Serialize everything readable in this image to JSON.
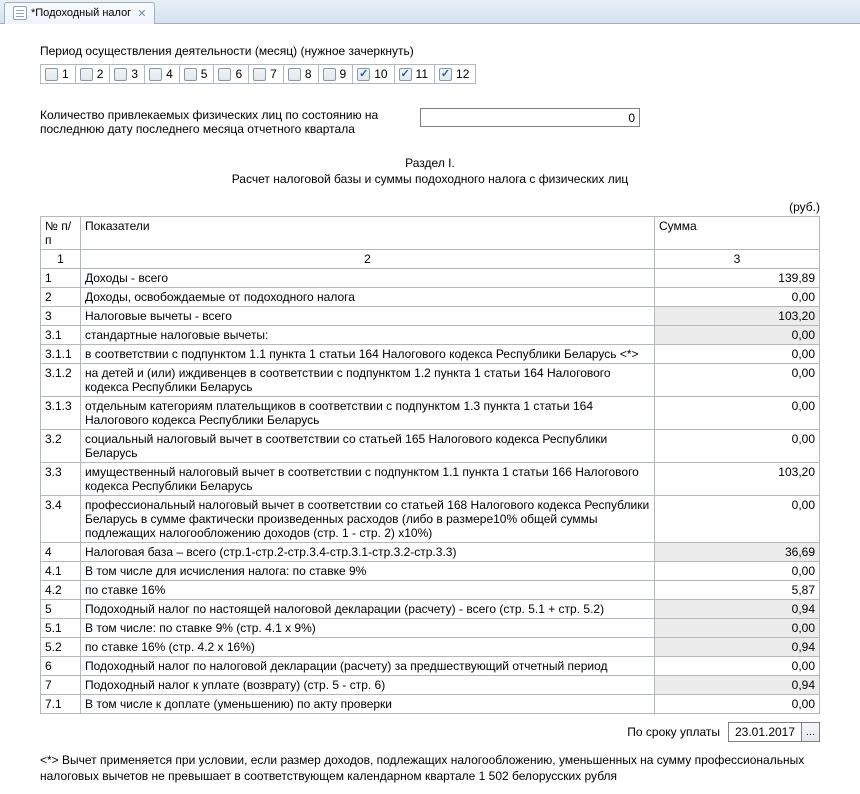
{
  "tab": {
    "title": "*Подоходный налог"
  },
  "period": {
    "label": "Период осуществления деятельности (месяц) (нужное зачеркнуть)",
    "months": [
      {
        "n": "1",
        "checked": false
      },
      {
        "n": "2",
        "checked": false
      },
      {
        "n": "3",
        "checked": false
      },
      {
        "n": "4",
        "checked": false
      },
      {
        "n": "5",
        "checked": false
      },
      {
        "n": "6",
        "checked": false
      },
      {
        "n": "7",
        "checked": false
      },
      {
        "n": "8",
        "checked": false
      },
      {
        "n": "9",
        "checked": false
      },
      {
        "n": "10",
        "checked": true
      },
      {
        "n": "11",
        "checked": true
      },
      {
        "n": "12",
        "checked": true
      }
    ]
  },
  "qty": {
    "label": "Количество привлекаемых физических лиц по состоянию на последнюю дату последнего месяца отчетного квартала",
    "value": "0"
  },
  "section": {
    "title": "Раздел I.",
    "subtitle": "Расчет налоговой базы и суммы подоходного налога с физических лиц",
    "unit": "(руб.)"
  },
  "table": {
    "headers": {
      "num": "№ п/п",
      "ind": "Показатели",
      "sum": "Сумма"
    },
    "subheaders": {
      "num": "1",
      "ind": "2",
      "sum": "3"
    },
    "rows": [
      {
        "n": "1",
        "ind": "Доходы - всего",
        "sum": "139,89",
        "gray": false
      },
      {
        "n": "2",
        "ind": "Доходы, освобождаемые от подоходного налога",
        "sum": "0,00",
        "gray": false
      },
      {
        "n": "3",
        "ind": "Налоговые вычеты - всего",
        "sum": "103,20",
        "gray": true
      },
      {
        "n": "3.1",
        "ind": "стандартные налоговые вычеты:",
        "sum": "0,00",
        "gray": true
      },
      {
        "n": "3.1.1",
        "ind": "в соответствии с подпунктом 1.1 пункта 1 статьи 164 Налогового кодекса Республики Беларусь <*>",
        "sum": "0,00",
        "gray": false
      },
      {
        "n": "3.1.2",
        "ind": "на детей и (или) иждивенцев в соответствии с подпунктом 1.2 пункта 1 статьи 164 Налогового кодекса Республики Беларусь",
        "sum": "0,00",
        "gray": false
      },
      {
        "n": "3.1.3",
        "ind": "отдельным категориям плательщиков в соответствии с подпунктом 1.3 пункта 1 статьи 164 Налогового кодекса Республики Беларусь",
        "sum": "0,00",
        "gray": false
      },
      {
        "n": "3.2",
        "ind": "социальный налоговый вычет в соответствии со статьей 165 Налогового кодекса Республики Беларусь",
        "sum": "0,00",
        "gray": false
      },
      {
        "n": "3.3",
        "ind": "имущественный налоговый вычет в соответствии с подпунктом 1.1 пункта 1 статьи 166 Налогового кодекса  Республики Беларусь",
        "sum": "103,20",
        "gray": false
      },
      {
        "n": "3.4",
        "ind": "профессиональный налоговый вычет в соответствии со статьей 168 Налогового кодекса Республики Беларусь в сумме фактически произведенных расходов (либо в размере10% общей суммы подлежащих налогообложению доходов (стр. 1 -  стр. 2) х10%)",
        "sum": "0,00",
        "gray": false
      },
      {
        "n": "4",
        "ind": "Налоговая база – всего (стр.1-стр.2-стр.3.4-стр.3.1-стр.3.2-стр.3.3)",
        "sum": "36,69",
        "gray": true
      },
      {
        "n": "4.1",
        "ind": "В том числе для исчисления налога: по ставке 9%",
        "sum": "0,00",
        "gray": false
      },
      {
        "n": "4.2",
        "ind": "по ставке 16%",
        "sum": "5,87",
        "gray": false
      },
      {
        "n": "5",
        "ind": "Подоходный налог по настоящей налоговой декларации (расчету) - всего (стр. 5.1 + стр. 5.2)",
        "sum": "0,94",
        "gray": true
      },
      {
        "n": "5.1",
        "ind": "В том числе: по ставке 9% (стр. 4.1 х 9%)",
        "sum": "0,00",
        "gray": true
      },
      {
        "n": "5.2",
        "ind": "по ставке 16% (стр. 4.2 х 16%)",
        "sum": "0,94",
        "gray": true
      },
      {
        "n": "6",
        "ind": "Подоходный налог по налоговой декларации (расчету) за предшествующий отчетный период",
        "sum": "0,00",
        "gray": false
      },
      {
        "n": "7",
        "ind": "Подоходный налог к уплате (возврату) (стр. 5 - стр. 6)",
        "sum": "0,94",
        "gray": true
      },
      {
        "n": "7.1",
        "ind": "В том числе к доплате (уменьшению) по акту проверки",
        "sum": "0,00",
        "gray": false
      }
    ]
  },
  "deadline": {
    "label": "По сроку уплаты",
    "value": "23.01.2017"
  },
  "footnote": "<*>  Вычет применяется при условии, если размер доходов, подлежащих налогообложению, уменьшенных на сумму профессиональных налоговых вычетов  не превышает в соответствующем календарном квартале 1 502  белорусских рубля"
}
